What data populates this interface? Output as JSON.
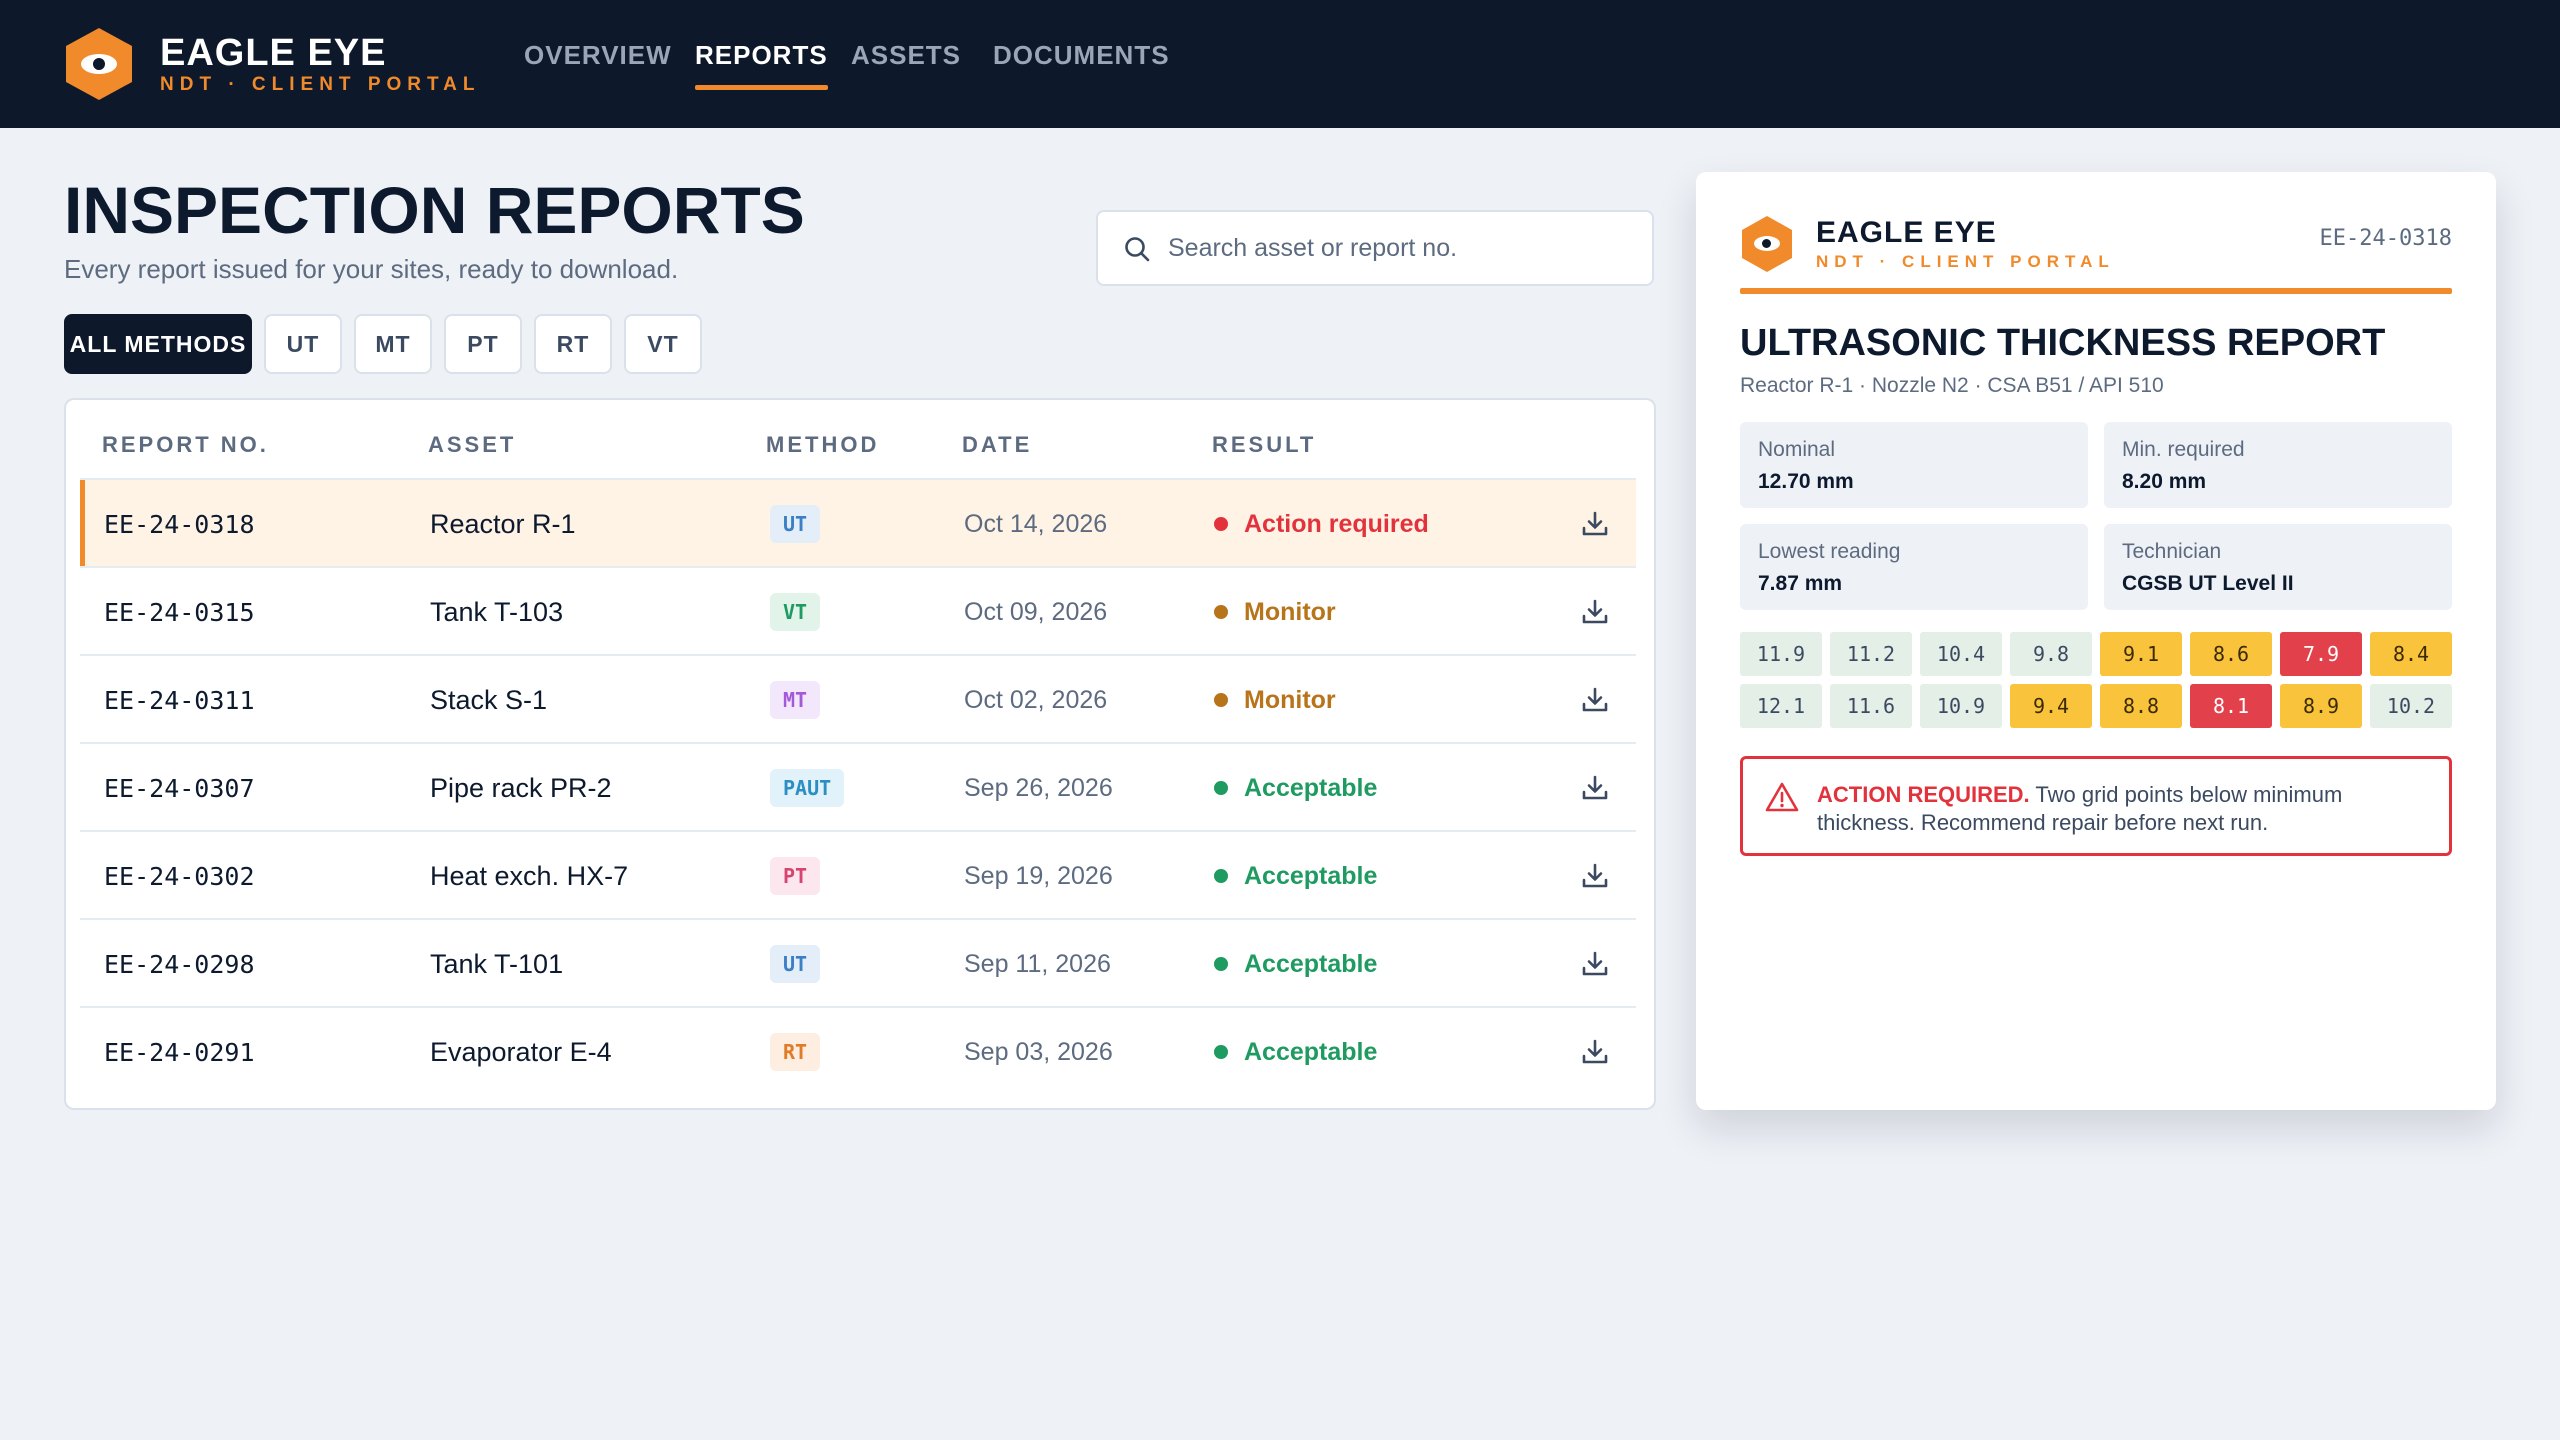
{
  "brand": {
    "name": "EAGLE EYE",
    "subtitle": "NDT · CLIENT PORTAL"
  },
  "nav": {
    "items": [
      {
        "label": "OVERVIEW",
        "active": false
      },
      {
        "label": "REPORTS",
        "active": true
      },
      {
        "label": "ASSETS",
        "active": false
      },
      {
        "label": "DOCUMENTS",
        "active": false
      }
    ]
  },
  "page": {
    "title": "INSPECTION REPORTS",
    "subtitle": "Every report issued for your sites, ready to download."
  },
  "search": {
    "placeholder": "Search asset or report no.",
    "value": ""
  },
  "filters": [
    "ALL METHODS",
    "UT",
    "MT",
    "PT",
    "RT",
    "VT"
  ],
  "table": {
    "headers": [
      "REPORT NO.",
      "ASSET",
      "METHOD",
      "DATE",
      "RESULT"
    ],
    "rows": [
      {
        "report_no": "EE-24-0318",
        "asset": "Reactor R-1",
        "method": "UT",
        "date": "Oct 14, 2026",
        "result": "Action required",
        "status": "danger",
        "selected": true
      },
      {
        "report_no": "EE-24-0315",
        "asset": "Tank T-103",
        "method": "VT",
        "date": "Oct 09, 2026",
        "result": "Monitor",
        "status": "warn",
        "selected": false
      },
      {
        "report_no": "EE-24-0311",
        "asset": "Stack S-1",
        "method": "MT",
        "date": "Oct 02, 2026",
        "result": "Monitor",
        "status": "warn",
        "selected": false
      },
      {
        "report_no": "EE-24-0307",
        "asset": "Pipe rack PR-2",
        "method": "PAUT",
        "date": "Sep 26, 2026",
        "result": "Acceptable",
        "status": "ok",
        "selected": false
      },
      {
        "report_no": "EE-24-0302",
        "asset": "Heat exch. HX-7",
        "method": "PT",
        "date": "Sep 19, 2026",
        "result": "Acceptable",
        "status": "ok",
        "selected": false
      },
      {
        "report_no": "EE-24-0298",
        "asset": "Tank T-101",
        "method": "UT",
        "date": "Sep 11, 2026",
        "result": "Acceptable",
        "status": "ok",
        "selected": false
      },
      {
        "report_no": "EE-24-0291",
        "asset": "Evaporator E-4",
        "method": "RT",
        "date": "Sep 03, 2026",
        "result": "Acceptable",
        "status": "ok",
        "selected": false
      }
    ]
  },
  "colors": {
    "accent": "#f08a2a",
    "navy": "#0d182b",
    "status": {
      "danger": "#e2333d",
      "warn": "#b8741a",
      "ok": "#1f9b62"
    },
    "methods": {
      "UT": {
        "bg": "#e4eef9",
        "fg": "#3b7fc4"
      },
      "VT": {
        "bg": "#e2f4ea",
        "fg": "#1f9b62"
      },
      "MT": {
        "bg": "#f3e8fb",
        "fg": "#a45ad6"
      },
      "PAUT": {
        "bg": "#e1f2fb",
        "fg": "#2b8fc4"
      },
      "PT": {
        "bg": "#fde7ef",
        "fg": "#d6456f"
      },
      "RT": {
        "bg": "#fdeee1",
        "fg": "#e07b27"
      }
    },
    "grid": {
      "ok": {
        "bg": "#e4efe8",
        "fg": "#3b4a60"
      },
      "warn": {
        "bg": "#f9c33b",
        "fg": "#3b2a05"
      },
      "bad": {
        "bg": "#e2404a",
        "fg": "#ffffff"
      }
    }
  },
  "detail": {
    "brand_name": "EAGLE EYE",
    "brand_subtitle": "NDT · CLIENT PORTAL",
    "report_no": "EE-24-0318",
    "title": "ULTRASONIC THICKNESS REPORT",
    "subtitle": "Reactor R-1 · Nozzle N2 · CSA B51 / API 510",
    "stats": [
      {
        "label": "Nominal",
        "value": "12.70 mm"
      },
      {
        "label": "Min. required",
        "value": "8.20 mm"
      },
      {
        "label": "Lowest reading",
        "value": "7.87 mm"
      },
      {
        "label": "Technician",
        "value": "CGSB UT Level II"
      }
    ],
    "grid": [
      [
        {
          "v": "11.9",
          "s": "ok"
        },
        {
          "v": "11.2",
          "s": "ok"
        },
        {
          "v": "10.4",
          "s": "ok"
        },
        {
          "v": "9.8",
          "s": "ok"
        },
        {
          "v": "9.1",
          "s": "warn"
        },
        {
          "v": "8.6",
          "s": "warn"
        },
        {
          "v": "7.9",
          "s": "bad"
        },
        {
          "v": "8.4",
          "s": "warn"
        }
      ],
      [
        {
          "v": "12.1",
          "s": "ok"
        },
        {
          "v": "11.6",
          "s": "ok"
        },
        {
          "v": "10.9",
          "s": "ok"
        },
        {
          "v": "9.4",
          "s": "warn"
        },
        {
          "v": "8.8",
          "s": "warn"
        },
        {
          "v": "8.1",
          "s": "bad"
        },
        {
          "v": "8.9",
          "s": "warn"
        },
        {
          "v": "10.2",
          "s": "ok"
        }
      ]
    ],
    "alert": {
      "strong": "ACTION REQUIRED.",
      "text": " Two grid points below minimum thickness. Recommend repair before next run."
    }
  }
}
